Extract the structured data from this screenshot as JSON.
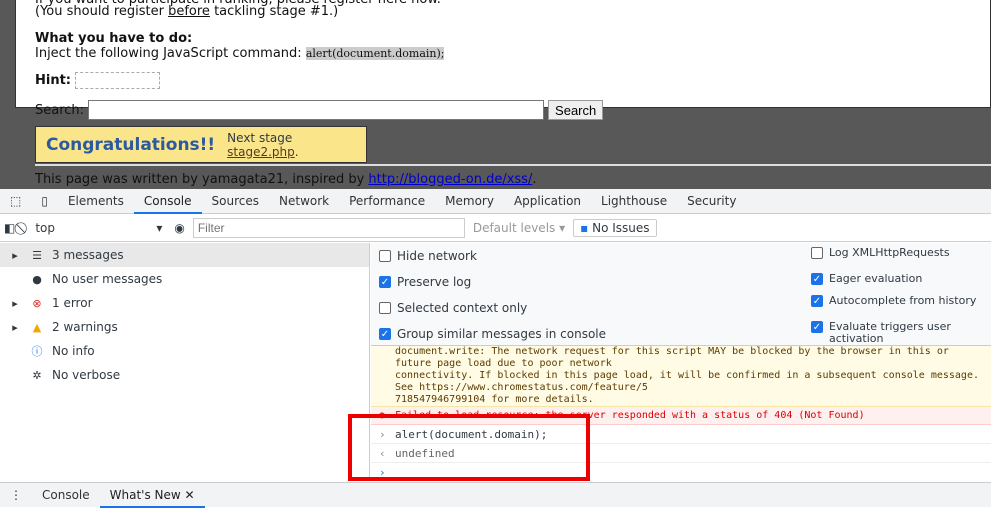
{
  "page": {
    "register_note_pre": "(You should register ",
    "register_link": "before",
    "register_note_post": " tackling stage #1.)",
    "todo_heading": "What you have to do:",
    "todo_text": "Inject the following JavaScript command: ",
    "todo_code": "alert(document.domain);",
    "hint_label": "Hint:",
    "search_label": "Search:",
    "search_value": "",
    "search_button": "Search",
    "congrats": "Congratulations!!",
    "next_pre": "Next stage ",
    "next_link": "stage2.php",
    "next_post": ".",
    "footer_pre": "This page was written by yamagata21, inspired by ",
    "footer_link": "http://blogged-on.de/xss/",
    "footer_post": "."
  },
  "devtools": {
    "tabs": [
      "Elements",
      "Console",
      "Sources",
      "Network",
      "Performance",
      "Memory",
      "Application",
      "Lighthouse",
      "Security"
    ],
    "active_tab": "Console",
    "toolbar": {
      "context": "top",
      "filter_placeholder": "Filter",
      "levels": "Default levels ▾",
      "issues": "No Issues"
    },
    "sidebar": [
      {
        "label": "3 messages",
        "icon": "list-icon"
      },
      {
        "label": "No user messages",
        "icon": "user-icon"
      },
      {
        "label": "1 error",
        "icon": "error-icon"
      },
      {
        "label": "2 warnings",
        "icon": "warning-icon"
      },
      {
        "label": "No info",
        "icon": "info-icon"
      },
      {
        "label": "No verbose",
        "icon": "bug-icon"
      }
    ],
    "settings_left": [
      {
        "label": "Hide network",
        "checked": false
      },
      {
        "label": "Preserve log",
        "checked": true
      },
      {
        "label": "Selected context only",
        "checked": false
      },
      {
        "label": "Group similar messages in console",
        "checked": true
      }
    ],
    "settings_right": [
      {
        "label": "Log XMLHttpRequests",
        "checked": false
      },
      {
        "label": "Eager evaluation",
        "checked": true
      },
      {
        "label": "Autocomplete from history",
        "checked": true
      },
      {
        "label": "Evaluate triggers user activation",
        "checked": true
      }
    ],
    "messages": {
      "warning_lines": [
        "document.write: The network request for this script MAY be blocked by the browser in this or future page load due to poor network",
        "connectivity. If blocked in this page load, it will be confirmed in a subsequent console message. See https://www.chromestatus.com/feature/5",
        "718547946799104 for more details."
      ],
      "error": "Failed to load resource: the server responded with a status of 404 (Not Found)",
      "input": "alert(document.domain);",
      "output": "undefined"
    },
    "drawer": {
      "tabs": [
        "Console",
        "What's New"
      ]
    }
  }
}
